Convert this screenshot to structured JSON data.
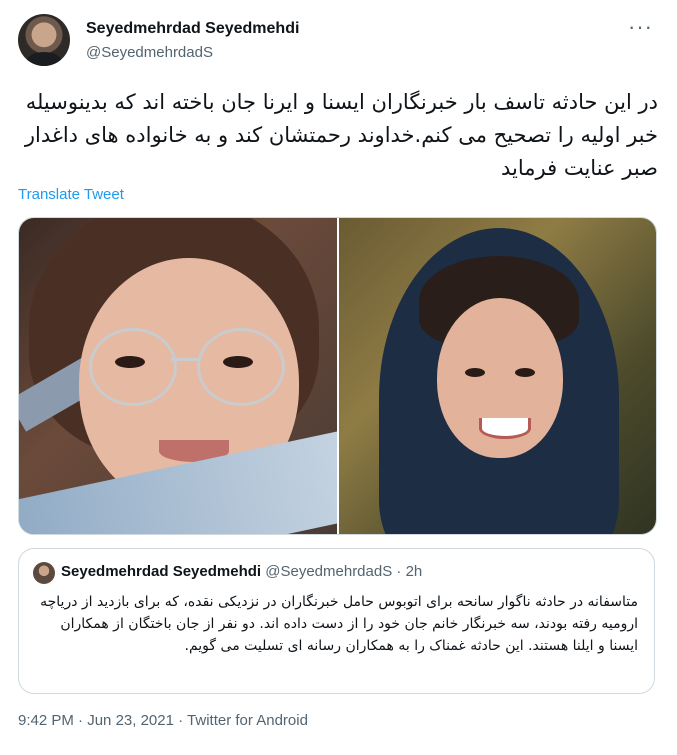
{
  "author": {
    "display_name": "Seyedmehrdad Seyedmehdi",
    "handle": "@SeyedmehrdadS"
  },
  "tweet": {
    "text": "در این حادثه تاسف بار خبرنگاران ایسنا و ایرنا جان باخته اند که بدینوسیله خبر اولیه را تصحیح می کنم.خداوند رحمتشان کند و به خانواده های داغدار صبر عنایت فرماید",
    "translate_label": "Translate Tweet"
  },
  "quoted_tweet": {
    "display_name": "Seyedmehrdad Seyedmehdi",
    "handle": "@SeyedmehrdadS",
    "separator": "·",
    "time": "2h",
    "text": "متاسفانه در حادثه ناگوار سانحه برای اتوبوس حامل خبرنگاران در نزدیکی نقده، که برای بازدید از دریاچه ارومیه رفته بودند، سه خبرنگار خانم جان خود را از دست داده اند. دو نفر از جان باختگان از همکاران ایسنا و ایلنا هستند. این حادثه غمناک را به همکاران رسانه ای تسلیت می گویم."
  },
  "footer": {
    "time": "9:42 PM",
    "sep1": "·",
    "date": "Jun 23, 2021",
    "sep2": "·",
    "source": "Twitter for Android"
  },
  "icons": {
    "more": "more-options-icon"
  },
  "colors": {
    "link": "#1d9bf0",
    "secondary_text": "#536471",
    "border": "#cfd9de"
  }
}
